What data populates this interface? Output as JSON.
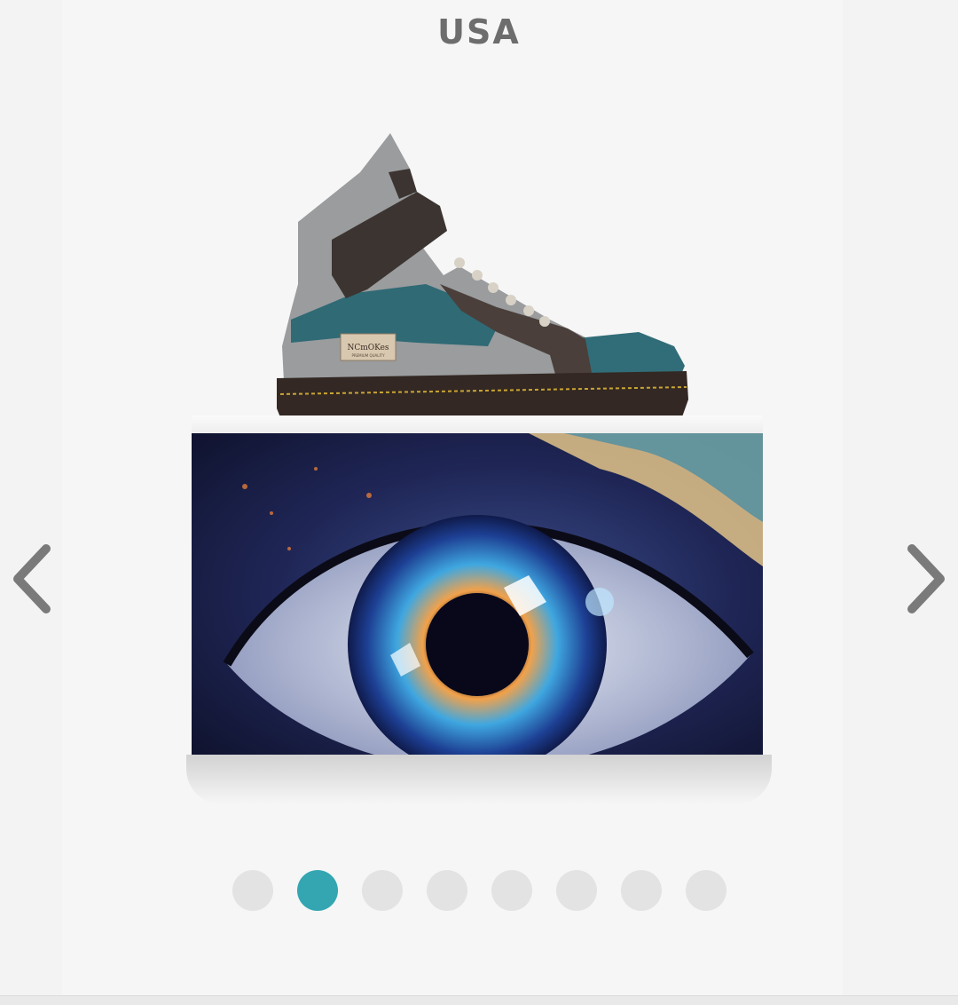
{
  "header": {
    "title": "USA"
  },
  "product": {
    "shoe_label_text": "NCmOKes",
    "shoe_label_subtext": "PREMIUM QUALITY"
  },
  "carousel": {
    "prev_icon": "chevron-left-icon",
    "next_icon": "chevron-right-icon",
    "total_slides": 8,
    "active_index": 1
  },
  "colors": {
    "accent": "#33a6b2",
    "arrow": "#7a7a7a"
  }
}
